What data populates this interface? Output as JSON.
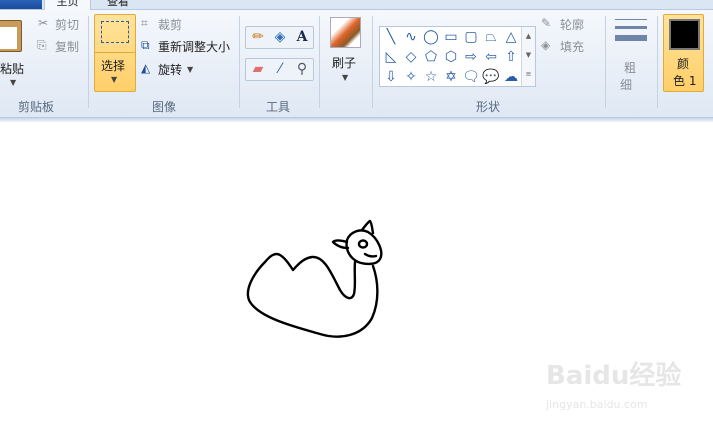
{
  "tabs": [
    {
      "label": "主页",
      "active": true
    },
    {
      "label": "查看",
      "active": false
    }
  ],
  "clipboard": {
    "paste": "粘贴",
    "cut": "剪切",
    "copy": "复制",
    "group": "剪贴板"
  },
  "image": {
    "select": "选择",
    "crop": "裁剪",
    "resize": "重新调整大小",
    "rotate": "旋转",
    "group": "图像"
  },
  "tools": {
    "group": "工具",
    "items": [
      "pencil-icon",
      "fill-icon",
      "text-icon",
      "eraser-icon",
      "color-picker-icon",
      "magnifier-icon"
    ]
  },
  "brush": {
    "label": "刷子"
  },
  "shapes": {
    "group": "形状",
    "outline": "轮廓",
    "fill": "填充",
    "items": [
      "╲",
      "∿",
      "◯",
      "▭",
      "▢",
      "⏢",
      "△",
      "◺",
      "◇",
      "⬠",
      "⬡",
      "⇨",
      "⇦",
      "⇧",
      "⇩",
      "✧",
      "☆",
      "✡",
      "🗨",
      "💬",
      "☁"
    ]
  },
  "size": {
    "label1": "粗",
    "label2": "细"
  },
  "color1": {
    "label1": "颜",
    "label2": "色 1",
    "value": "#000000"
  },
  "watermark": {
    "brand": "Baidu经验",
    "url": "jingyan.baidu.com"
  }
}
